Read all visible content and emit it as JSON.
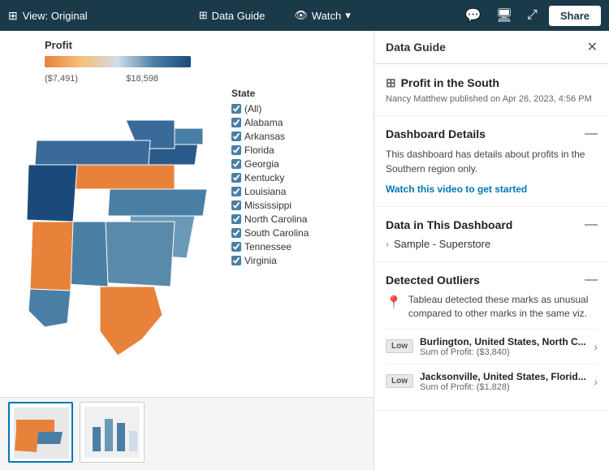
{
  "topbar": {
    "view_label": "View: Original",
    "data_guide_label": "Data Guide",
    "watch_label": "Watch",
    "share_label": "Share"
  },
  "chart": {
    "title": "Profit",
    "legend_min": "($7,491)",
    "legend_max": "$18,598"
  },
  "filter": {
    "title": "State",
    "items": [
      "(All)",
      "Alabama",
      "Arkansas",
      "Florida",
      "Georgia",
      "Kentucky",
      "Louisiana",
      "Mississippi",
      "North Carolina",
      "South Carolina",
      "Tennessee",
      "Virginia"
    ]
  },
  "data_guide": {
    "panel_title": "Data Guide",
    "view_title": "Profit in the South",
    "view_subtitle": "Nancy Matthew published on Apr 26, 2023, 4:56 PM",
    "sections": {
      "dashboard_details": {
        "title": "Dashboard Details",
        "description": "This dashboard has details about profits in the Southern region only.",
        "link": "Watch this video to get started"
      },
      "data_in_dashboard": {
        "title": "Data in This Dashboard",
        "item": "Sample - Superstore"
      },
      "detected_outliers": {
        "title": "Detected Outliers",
        "description": "Tableau detected these marks as unusual compared to other marks in the same viz.",
        "outliers": [
          {
            "badge": "Low",
            "name": "Burlington, United States, North C...",
            "value": "Sum of Profit: ($3,840)"
          },
          {
            "badge": "Low",
            "name": "Jacksonville, United States, Florid...",
            "value": "Sum of Profit: ($1,828)"
          }
        ]
      }
    }
  }
}
